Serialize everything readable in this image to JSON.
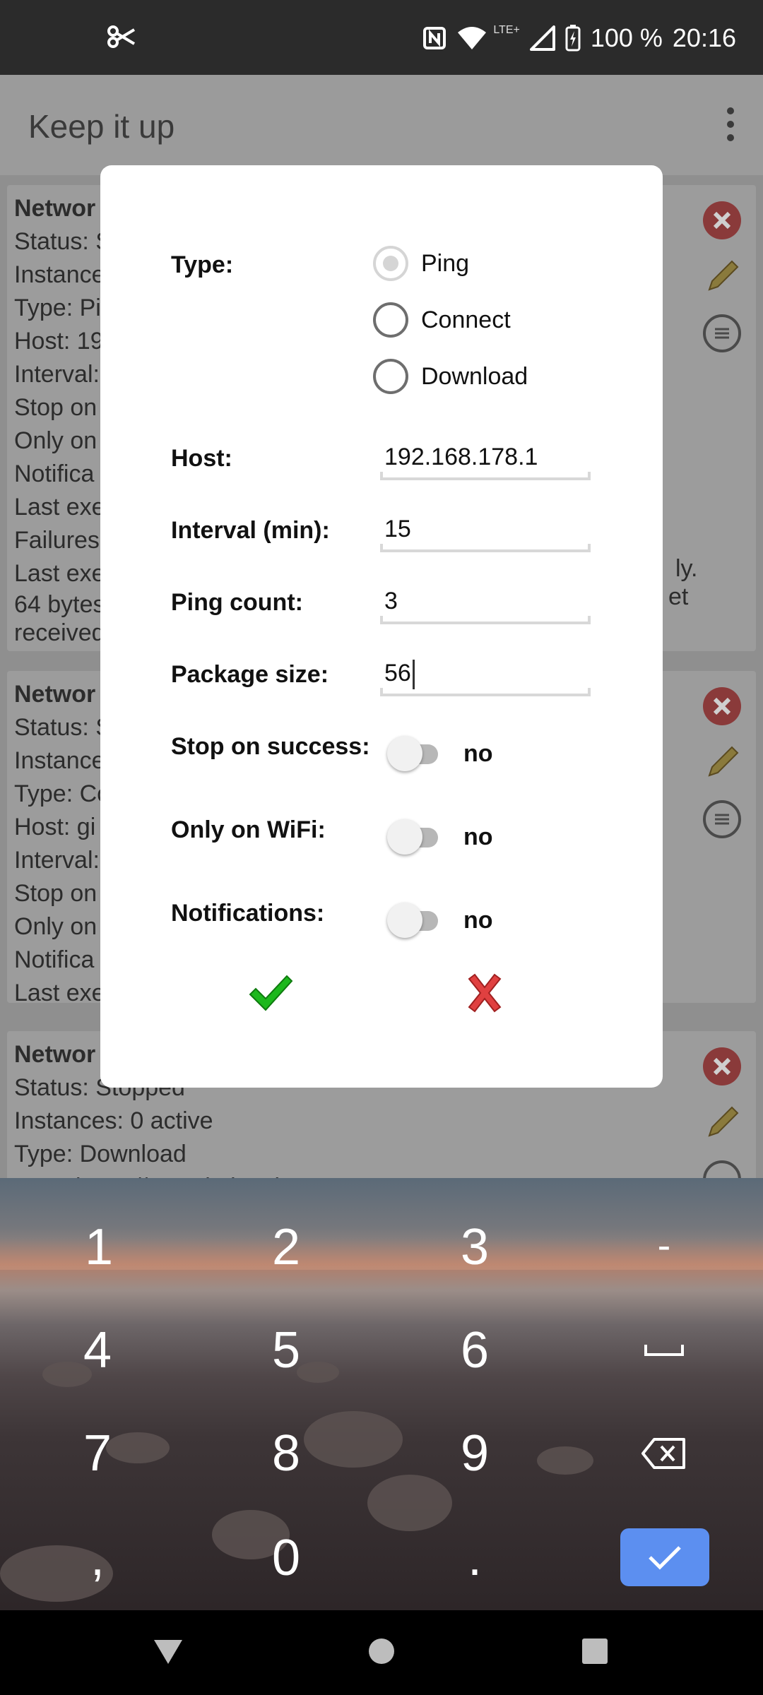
{
  "status_bar": {
    "battery": "100 %",
    "time": "20:16",
    "network_label": "LTE+"
  },
  "app_bar": {
    "title": "Keep it up"
  },
  "background_cards": [
    {
      "lines": [
        "Networ",
        "Status: S",
        "Instance",
        "Type: Pi",
        "Host: 19",
        "Interval:",
        "Stop on",
        "Only on",
        "Notifica",
        "Last exe",
        "Failures",
        "Last exe",
        "64 bytes",
        "received"
      ],
      "right_text_1": "ly.",
      "right_text_2": "et"
    },
    {
      "lines": [
        "Networ",
        "Status: S",
        "Instance",
        "Type: Co",
        "Host: gi",
        "Interval:",
        "Stop on",
        "Only on",
        "Notifica",
        "Last exe"
      ]
    },
    {
      "lines": [
        "Networ",
        "Status: Stopped",
        "Instances: 0 active",
        "Type: Download",
        "URL: https://www.bcicopl..."
      ]
    }
  ],
  "dialog": {
    "type_label": "Type:",
    "type_options": [
      {
        "label": "Ping",
        "checked": true
      },
      {
        "label": "Connect",
        "checked": false
      },
      {
        "label": "Download",
        "checked": false
      }
    ],
    "host_label": "Host:",
    "host_value": "192.168.178.1",
    "interval_label": "Interval (min):",
    "interval_value": "15",
    "ping_count_label": "Ping count:",
    "ping_count_value": "3",
    "package_size_label": "Package size:",
    "package_size_value": "56",
    "stop_on_success_label": "Stop on success:",
    "stop_on_success_value": "no",
    "only_on_wifi_label": "Only on WiFi:",
    "only_on_wifi_value": "no",
    "notifications_label": "Notifications:",
    "notifications_value": "no"
  },
  "keyboard": {
    "rows": [
      [
        "1",
        "2",
        "3",
        "-"
      ],
      [
        "4",
        "5",
        "6",
        "␣"
      ],
      [
        "7",
        "8",
        "9",
        "⌫"
      ],
      [
        ",",
        "0",
        ".",
        "✓"
      ]
    ],
    "accent": "#5c8ff0"
  }
}
